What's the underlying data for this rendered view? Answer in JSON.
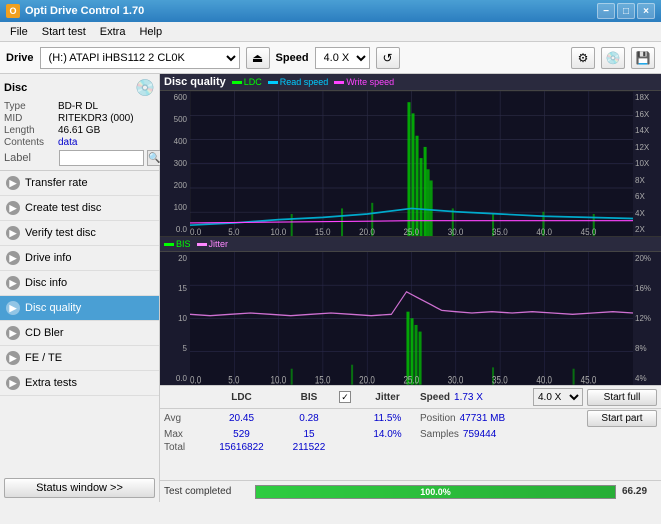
{
  "titlebar": {
    "icon": "O",
    "title": "Opti Drive Control 1.70",
    "minimize": "−",
    "maximize": "□",
    "close": "×"
  },
  "menubar": {
    "items": [
      "File",
      "Start test",
      "Extra",
      "Help"
    ]
  },
  "toolbar": {
    "drive_label": "Drive",
    "drive_value": "(H:) ATAPI iHBS112  2 CL0K",
    "speed_label": "Speed",
    "speed_value": "4.0 X"
  },
  "disc_info": {
    "title": "Disc",
    "type_label": "Type",
    "type_value": "BD-R DL",
    "mid_label": "MID",
    "mid_value": "RITEKDR3 (000)",
    "length_label": "Length",
    "length_value": "46.61 GB",
    "contents_label": "Contents",
    "contents_value": "data",
    "label_label": "Label",
    "label_placeholder": ""
  },
  "sidebar_items": [
    {
      "id": "transfer-rate",
      "label": "Transfer rate",
      "active": false
    },
    {
      "id": "create-test-disc",
      "label": "Create test disc",
      "active": false
    },
    {
      "id": "verify-test-disc",
      "label": "Verify test disc",
      "active": false
    },
    {
      "id": "drive-info",
      "label": "Drive info",
      "active": false
    },
    {
      "id": "disc-info",
      "label": "Disc info",
      "active": false
    },
    {
      "id": "disc-quality",
      "label": "Disc quality",
      "active": true
    },
    {
      "id": "cd-bler",
      "label": "CD Bler",
      "active": false
    },
    {
      "id": "fe-te",
      "label": "FE / TE",
      "active": false
    },
    {
      "id": "extra-tests",
      "label": "Extra tests",
      "active": false
    }
  ],
  "status_btn": "Status window >>",
  "chart_top": {
    "title": "Disc quality",
    "legend": [
      {
        "label": "LDC",
        "color": "#00ff00"
      },
      {
        "label": "Read speed",
        "color": "#00ccff"
      },
      {
        "label": "Write speed",
        "color": "#ff44ff"
      }
    ],
    "x_max": "50.0 GB",
    "y_right_labels": [
      "18X",
      "16X",
      "14X",
      "12X",
      "10X",
      "8X",
      "6X",
      "4X",
      "2X"
    ]
  },
  "chart_bottom": {
    "legend": [
      {
        "label": "BIS",
        "color": "#00ff00"
      },
      {
        "label": "Jitter",
        "color": "#ff88ff"
      }
    ],
    "x_max": "50.0 GB",
    "y_right_labels": [
      "20%",
      "16%",
      "12%",
      "8%",
      "4%"
    ]
  },
  "stats": {
    "headers": [
      "LDC",
      "BIS",
      "",
      "Jitter",
      "Speed",
      ""
    ],
    "avg_label": "Avg",
    "avg_ldc": "20.45",
    "avg_bis": "0.28",
    "avg_jitter": "11.5%",
    "max_label": "Max",
    "max_ldc": "529",
    "max_bis": "15",
    "max_jitter": "14.0%",
    "total_label": "Total",
    "total_ldc": "15616822",
    "total_bis": "211522",
    "speed_label": "Speed",
    "speed_value": "1.73 X",
    "speed_unit": "4.0 X",
    "position_label": "Position",
    "position_value": "47731 MB",
    "samples_label": "Samples",
    "samples_value": "759444",
    "jitter_checked": true,
    "btn_start_full": "Start full",
    "btn_start_part": "Start part"
  },
  "progressbar": {
    "percent": 100.0,
    "display_pct": "100.0%",
    "extra_value": "66.29",
    "status": "Test completed"
  }
}
